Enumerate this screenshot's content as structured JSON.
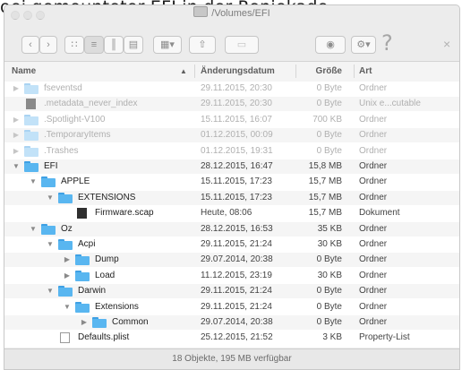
{
  "background_caption": "oei gemounteter EFI in der Reniekade",
  "window": {
    "title": "/Volumes/EFI",
    "help_label": "?",
    "close_label": "×"
  },
  "toolbar": {
    "back_icon": "chevron-left-icon",
    "forward_icon": "chevron-right-icon",
    "view_icons": "view-icons-icon",
    "view_list": "view-list-icon",
    "view_columns": "view-columns-icon",
    "view_coverflow": "view-coverflow-icon",
    "arrange_icon": "arrange-icon",
    "share_icon": "share-icon",
    "tag_icon": "tag-icon",
    "eye_icon": "eye-icon",
    "action_icon": "gear-icon"
  },
  "columns": {
    "name": "Name",
    "date": "Änderungsdatum",
    "size": "Größe",
    "kind": "Art"
  },
  "rows": [
    {
      "name": "fseventsd",
      "date": "29.11.2015, 20:30",
      "size": "0 Byte",
      "kind": "Ordner",
      "indent": 0,
      "disclosure": "right",
      "icon": "folder",
      "dim": true
    },
    {
      "name": ".metadata_never_index",
      "date": "29.11.2015, 20:30",
      "size": "0 Byte",
      "kind": "Unix e...cutable",
      "indent": 0,
      "disclosure": "none",
      "icon": "file-dark",
      "dim": true
    },
    {
      "name": ".Spotlight-V100",
      "date": "15.11.2015, 16:07",
      "size": "700 KB",
      "kind": "Ordner",
      "indent": 0,
      "disclosure": "right",
      "icon": "folder",
      "dim": true
    },
    {
      "name": ".TemporaryItems",
      "date": "01.12.2015, 00:09",
      "size": "0 Byte",
      "kind": "Ordner",
      "indent": 0,
      "disclosure": "right",
      "icon": "folder",
      "dim": true
    },
    {
      "name": ".Trashes",
      "date": "01.12.2015, 19:31",
      "size": "0 Byte",
      "kind": "Ordner",
      "indent": 0,
      "disclosure": "right",
      "icon": "folder",
      "dim": true
    },
    {
      "name": "EFI",
      "date": "28.12.2015, 16:47",
      "size": "15,8 MB",
      "kind": "Ordner",
      "indent": 0,
      "disclosure": "down",
      "icon": "folder",
      "dim": false
    },
    {
      "name": "APPLE",
      "date": "15.11.2015, 17:23",
      "size": "15,7 MB",
      "kind": "Ordner",
      "indent": 1,
      "disclosure": "down",
      "icon": "folder",
      "dim": false
    },
    {
      "name": "EXTENSIONS",
      "date": "15.11.2015, 17:23",
      "size": "15,7 MB",
      "kind": "Ordner",
      "indent": 2,
      "disclosure": "down",
      "icon": "folder",
      "dim": false
    },
    {
      "name": "Firmware.scap",
      "date": "Heute, 08:06",
      "size": "15,7 MB",
      "kind": "Dokument",
      "indent": 3,
      "disclosure": "none",
      "icon": "file-dark",
      "dim": false
    },
    {
      "name": "Oz",
      "date": "28.12.2015, 16:53",
      "size": "35 KB",
      "kind": "Ordner",
      "indent": 1,
      "disclosure": "down",
      "icon": "folder",
      "dim": false
    },
    {
      "name": "Acpi",
      "date": "29.11.2015, 21:24",
      "size": "30 KB",
      "kind": "Ordner",
      "indent": 2,
      "disclosure": "down",
      "icon": "folder",
      "dim": false
    },
    {
      "name": "Dump",
      "date": "29.07.2014, 20:38",
      "size": "0 Byte",
      "kind": "Ordner",
      "indent": 3,
      "disclosure": "right",
      "icon": "folder",
      "dim": false
    },
    {
      "name": "Load",
      "date": "11.12.2015, 23:19",
      "size": "30 KB",
      "kind": "Ordner",
      "indent": 3,
      "disclosure": "right",
      "icon": "folder",
      "dim": false
    },
    {
      "name": "Darwin",
      "date": "29.11.2015, 21:24",
      "size": "0 Byte",
      "kind": "Ordner",
      "indent": 2,
      "disclosure": "down",
      "icon": "folder",
      "dim": false
    },
    {
      "name": "Extensions",
      "date": "29.11.2015, 21:24",
      "size": "0 Byte",
      "kind": "Ordner",
      "indent": 3,
      "disclosure": "down",
      "icon": "folder",
      "dim": false
    },
    {
      "name": "Common",
      "date": "29.07.2014, 20:38",
      "size": "0 Byte",
      "kind": "Ordner",
      "indent": 4,
      "disclosure": "right",
      "icon": "folder",
      "dim": false
    },
    {
      "name": "Defaults.plist",
      "date": "25.12.2015, 21:52",
      "size": "3 KB",
      "kind": "Property-List",
      "indent": 2,
      "disclosure": "none",
      "icon": "file-white",
      "dim": false
    }
  ],
  "status": "18 Objekte, 195 MB verfügbar",
  "colors": {
    "folder": "#59b6f0",
    "folder_dim": "#c2e2f8",
    "window_bg": "#ececec"
  }
}
